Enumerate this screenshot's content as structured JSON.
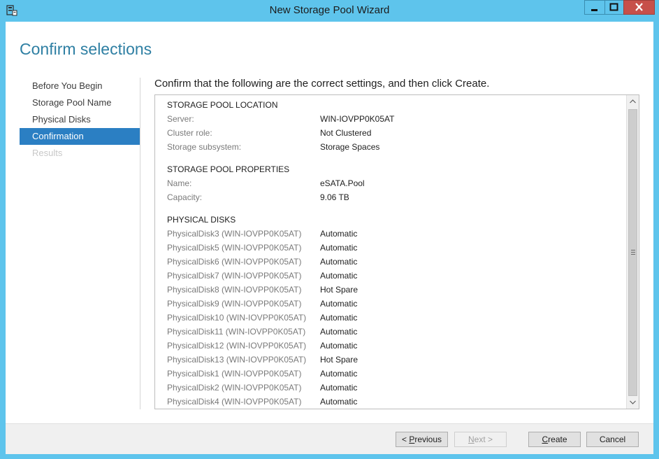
{
  "window": {
    "title": "New Storage Pool Wizard"
  },
  "page_title": "Confirm selections",
  "nav": [
    {
      "label": "Before You Begin",
      "state": "normal"
    },
    {
      "label": "Storage Pool Name",
      "state": "normal"
    },
    {
      "label": "Physical Disks",
      "state": "normal"
    },
    {
      "label": "Confirmation",
      "state": "active"
    },
    {
      "label": "Results",
      "state": "disabled"
    }
  ],
  "instruction": "Confirm that the following are the correct settings, and then click Create.",
  "location": {
    "heading": "STORAGE POOL LOCATION",
    "rows": [
      {
        "k": "Server:",
        "v": "WIN-IOVPP0K05AT"
      },
      {
        "k": "Cluster role:",
        "v": "Not Clustered"
      },
      {
        "k": "Storage subsystem:",
        "v": "Storage Spaces"
      }
    ]
  },
  "properties": {
    "heading": "STORAGE POOL PROPERTIES",
    "rows": [
      {
        "k": "Name:",
        "v": "eSATA.Pool"
      },
      {
        "k": "Capacity:",
        "v": "9.06 TB"
      }
    ]
  },
  "disks": {
    "heading": "PHYSICAL DISKS",
    "rows": [
      {
        "k": "PhysicalDisk3 (WIN-IOVPP0K05AT)",
        "v": "Automatic"
      },
      {
        "k": "PhysicalDisk5 (WIN-IOVPP0K05AT)",
        "v": "Automatic"
      },
      {
        "k": "PhysicalDisk6 (WIN-IOVPP0K05AT)",
        "v": "Automatic"
      },
      {
        "k": "PhysicalDisk7 (WIN-IOVPP0K05AT)",
        "v": "Automatic"
      },
      {
        "k": "PhysicalDisk8 (WIN-IOVPP0K05AT)",
        "v": "Hot Spare"
      },
      {
        "k": "PhysicalDisk9 (WIN-IOVPP0K05AT)",
        "v": "Automatic"
      },
      {
        "k": "PhysicalDisk10 (WIN-IOVPP0K05AT)",
        "v": "Automatic"
      },
      {
        "k": "PhysicalDisk11 (WIN-IOVPP0K05AT)",
        "v": "Automatic"
      },
      {
        "k": "PhysicalDisk12 (WIN-IOVPP0K05AT)",
        "v": "Automatic"
      },
      {
        "k": "PhysicalDisk13 (WIN-IOVPP0K05AT)",
        "v": "Hot Spare"
      },
      {
        "k": "PhysicalDisk1 (WIN-IOVPP0K05AT)",
        "v": "Automatic"
      },
      {
        "k": "PhysicalDisk2 (WIN-IOVPP0K05AT)",
        "v": "Automatic"
      },
      {
        "k": "PhysicalDisk4 (WIN-IOVPP0K05AT)",
        "v": "Automatic"
      }
    ]
  },
  "buttons": {
    "previous": {
      "pre": "< ",
      "accel": "P",
      "post": "revious"
    },
    "next": {
      "pre": "",
      "accel": "N",
      "post": "ext >"
    },
    "create": {
      "pre": "",
      "accel": "C",
      "post": "reate"
    },
    "cancel": {
      "label": "Cancel"
    }
  },
  "icons": {
    "app": "server-manager-icon",
    "minimize": "minimize-icon",
    "maximize": "maximize-icon",
    "close": "close-icon",
    "scroll_up": "chevron-up-icon",
    "scroll_down": "chevron-down-icon",
    "grip": "scroll-grip-icon"
  },
  "colors": {
    "titlebar": "#5ec4ec",
    "accent": "#2b7fc3",
    "page_title": "#2e7fa3",
    "close_button": "#c7504a"
  }
}
